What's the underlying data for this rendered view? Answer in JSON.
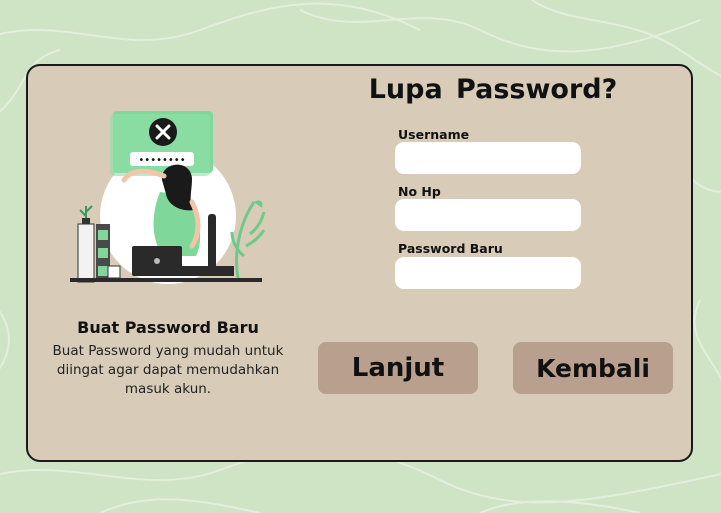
{
  "page": {
    "title": "Lupa Password?"
  },
  "illustration": {
    "error_icon": "close-icon",
    "password_mask": "••••••••"
  },
  "info": {
    "heading": "Buat Password Baru",
    "description": "Buat Password yang mudah untuk diingat agar dapat memudahkan masuk akun."
  },
  "form": {
    "username_label": "Username",
    "username_value": "",
    "phone_label": "No Hp",
    "phone_value": "",
    "new_password_label": "Password Baru",
    "new_password_value": ""
  },
  "actions": {
    "next_label": "Lanjut",
    "back_label": "Kembali"
  },
  "colors": {
    "background": "#cfe3c5",
    "card": "#d8ccb8",
    "button": "#b89f8e",
    "accent_green": "#7fd89a"
  }
}
